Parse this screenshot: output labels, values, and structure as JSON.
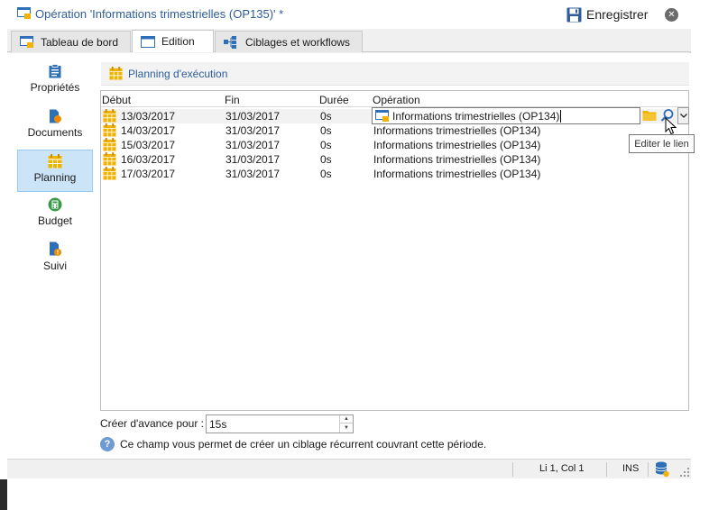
{
  "window": {
    "title": "Opération 'Informations trimestrielles (OP135)' *",
    "save_label": "Enregistrer",
    "close_symbol": "✕"
  },
  "tabs": [
    {
      "label": "Tableau de bord",
      "icon": "dashboard-icon"
    },
    {
      "label": "Edition",
      "icon": "edit-window-icon",
      "active": true
    },
    {
      "label": "Ciblages et workflows",
      "icon": "workflow-icon"
    }
  ],
  "sidebar": {
    "items": [
      {
        "label": "Propriétés",
        "icon": "clipboard-icon"
      },
      {
        "label": "Documents",
        "icon": "document-icon"
      },
      {
        "label": "Planning",
        "icon": "calendar-icon",
        "active": true
      },
      {
        "label": "Budget",
        "icon": "calculator-icon"
      },
      {
        "label": "Suivi",
        "icon": "tracking-icon"
      }
    ]
  },
  "section": {
    "title": "Planning d'exécution",
    "icon": "calendar-icon"
  },
  "grid": {
    "columns": [
      "Début",
      "Fin",
      "Durée",
      "Opération"
    ],
    "rows": [
      {
        "debut": "13/03/2017",
        "fin": "31/03/2017",
        "duree": "0s",
        "operation": "Informations trimestrielles (OP134)",
        "editing": true
      },
      {
        "debut": "14/03/2017",
        "fin": "31/03/2017",
        "duree": "0s",
        "operation": "Informations trimestrielles (OP134)"
      },
      {
        "debut": "15/03/2017",
        "fin": "31/03/2017",
        "duree": "0s",
        "operation": "Informations trimestrielles (OP134)"
      },
      {
        "debut": "16/03/2017",
        "fin": "31/03/2017",
        "duree": "0s",
        "operation": "Informations trimestrielles (OP134)"
      },
      {
        "debut": "17/03/2017",
        "fin": "31/03/2017",
        "duree": "0s",
        "operation": "Informations trimestrielles (OP134)"
      }
    ],
    "tooltip": "Editer le lien"
  },
  "form": {
    "advance_label": "Créer d'avance pour :",
    "advance_value": "15s",
    "help_text": "Ce champ vous permet de créer un ciblage récurrent couvrant cette période."
  },
  "status": {
    "position": "Li 1, Col 1",
    "mode": "INS"
  },
  "colors": {
    "accent": "#2e5d9a",
    "calendar": "#f0b400",
    "selected_nav": "#cce4f7"
  }
}
